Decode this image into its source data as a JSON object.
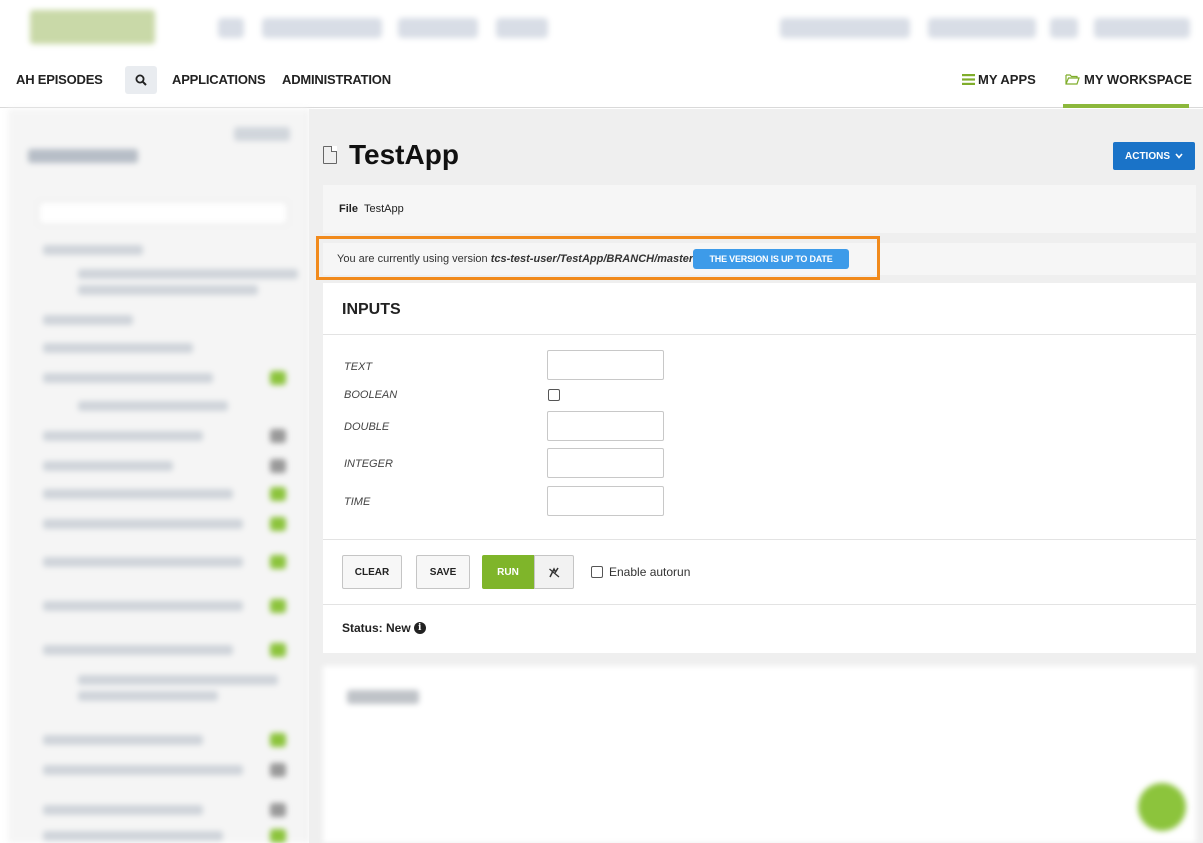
{
  "nav": {
    "items": [
      "AH EPISODES",
      "APPLICATIONS",
      "ADMINISTRATION"
    ],
    "my_apps": "MY APPS",
    "my_workspace": "MY WORKSPACE"
  },
  "page": {
    "title": "TestApp",
    "actions_label": "ACTIONS"
  },
  "file": {
    "label": "File",
    "name": "TestApp"
  },
  "version": {
    "prefix": "You are currently using version",
    "path": "tcs-test-user/TestApp/BRANCH/master",
    "badge": "THE VERSION IS UP TO DATE"
  },
  "inputs": {
    "title": "INPUTS",
    "fields": [
      {
        "label": "TEXT",
        "value": ""
      },
      {
        "label": "BOOLEAN",
        "checked": false
      },
      {
        "label": "DOUBLE",
        "value": ""
      },
      {
        "label": "INTEGER",
        "value": ""
      },
      {
        "label": "TIME",
        "value": ""
      }
    ]
  },
  "buttons": {
    "clear": "CLEAR",
    "save": "SAVE",
    "run": "RUN",
    "autorun_label": "Enable autorun",
    "autorun_checked": false
  },
  "status": {
    "text": "Status: New"
  },
  "colors": {
    "accent_green": "#7fb52a",
    "actions_blue": "#1a73c8",
    "badge_blue": "#3d9be9",
    "highlight_orange": "#f18a1c"
  }
}
